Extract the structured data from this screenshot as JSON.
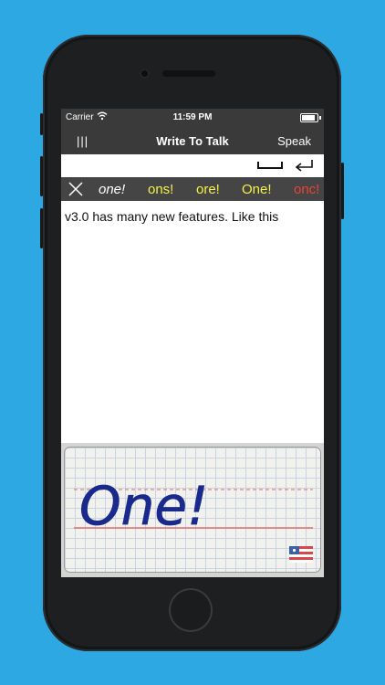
{
  "status_bar": {
    "carrier": "Carrier",
    "time": "11:59 PM"
  },
  "nav_bar": {
    "menu_label": "|||",
    "title": "Write To Talk",
    "speak_label": "Speak"
  },
  "suggestions": [
    {
      "text": "one!",
      "color": "#ffffff",
      "italic": true
    },
    {
      "text": "ons!",
      "color": "#f2f24a",
      "italic": false
    },
    {
      "text": "ore!",
      "color": "#f2f24a",
      "italic": false
    },
    {
      "text": "One!",
      "color": "#f2f24a",
      "italic": false
    },
    {
      "text": "onc!",
      "color": "#e8433a",
      "italic": false
    }
  ],
  "text_area": {
    "content": "v3.0 has many new features. Like this"
  },
  "handwriting": {
    "ink_text": "One!",
    "ink_color": "#1a2a8c",
    "language_flag": "us-flag-icon"
  },
  "colors": {
    "background": "#2ea8e2",
    "bar": "#3a3a3a",
    "suggestion_bar": "#454545"
  }
}
